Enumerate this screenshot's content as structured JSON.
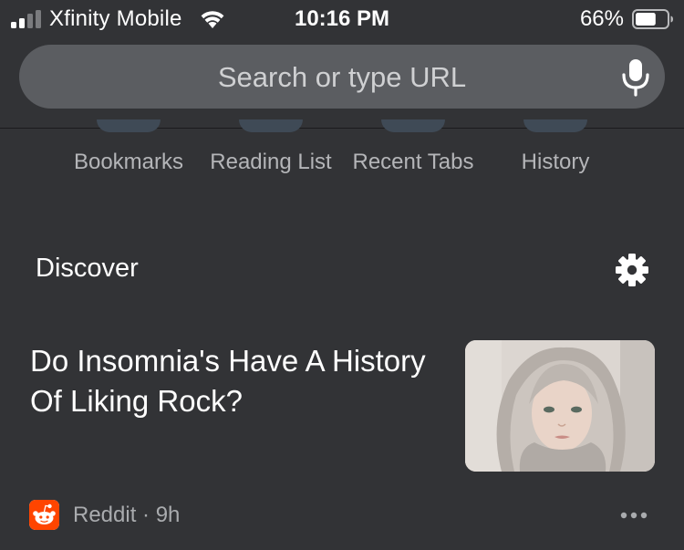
{
  "status_bar": {
    "carrier": "Xfinity Mobile",
    "time": "10:16 PM",
    "battery_percent": "66%",
    "battery_level": 0.66,
    "signal_icon": "cellular-signal-icon",
    "wifi_icon": "wifi-icon",
    "battery_icon": "battery-icon"
  },
  "search": {
    "placeholder": "Search or type URL",
    "mic_icon": "microphone-icon"
  },
  "shortcuts": [
    {
      "label": "Bookmarks"
    },
    {
      "label": "Reading List"
    },
    {
      "label": "Recent Tabs"
    },
    {
      "label": "History"
    }
  ],
  "discover": {
    "title": "Discover",
    "settings_icon": "gear-icon"
  },
  "article": {
    "title": "Do Insomnia's Have A History Of Liking Rock?",
    "source": "Reddit",
    "age": "9h",
    "separator": " · ",
    "thumbnail_description_icon": "portrait-thumbnail",
    "source_logo_icon": "reddit-logo-icon",
    "more_icon": "more-horizontal-icon"
  },
  "colors": {
    "background": "#323336",
    "search_bar": "#5b5d61",
    "reddit_orange": "#ff4500"
  }
}
